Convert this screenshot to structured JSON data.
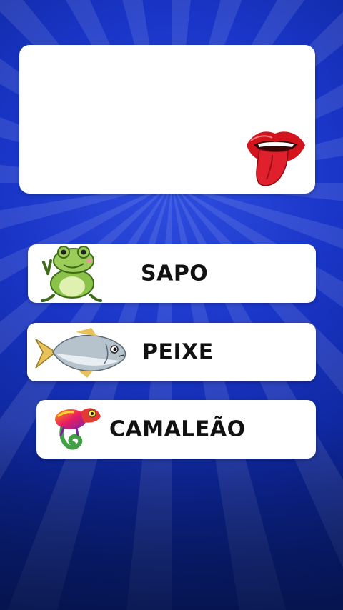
{
  "options": [
    {
      "label": "SAPO",
      "icon": "frog-icon"
    },
    {
      "label": "PEIXE",
      "icon": "fish-icon"
    },
    {
      "label": "CAMALEÃO",
      "icon": "chameleon-icon"
    }
  ],
  "clue": {
    "icon": "mouth-tongue-icon"
  },
  "colors": {
    "background": "#1a36c9",
    "card": "#ffffff",
    "text": "#111111"
  }
}
